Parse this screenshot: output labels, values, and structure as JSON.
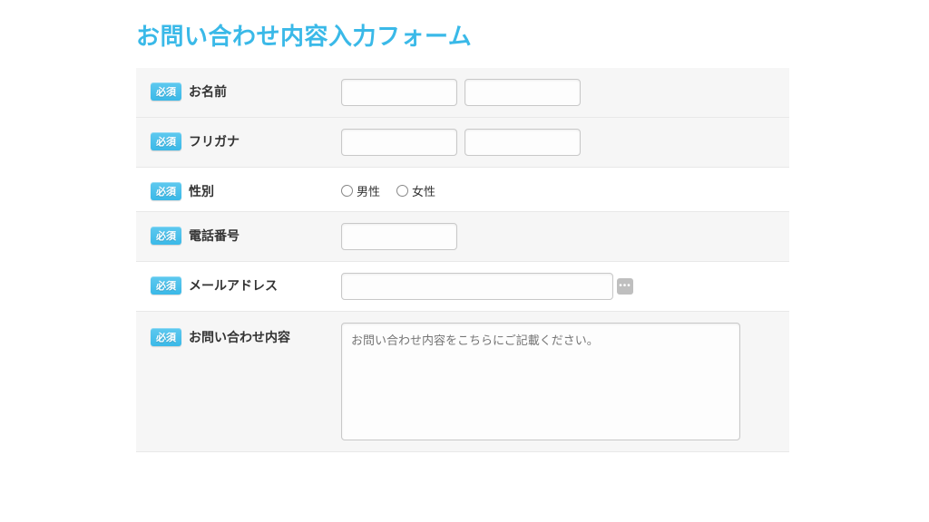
{
  "title": "お問い合わせ内容入力フォーム",
  "requiredBadge": "必須",
  "fields": {
    "name": {
      "label": "お名前"
    },
    "furigana": {
      "label": "フリガナ"
    },
    "gender": {
      "label": "性別",
      "options": {
        "male": "男性",
        "female": "女性"
      }
    },
    "phone": {
      "label": "電話番号"
    },
    "email": {
      "label": "メールアドレス"
    },
    "inquiry": {
      "label": "お問い合わせ内容",
      "placeholder": "お問い合わせ内容をこちらにご記載ください。"
    }
  }
}
